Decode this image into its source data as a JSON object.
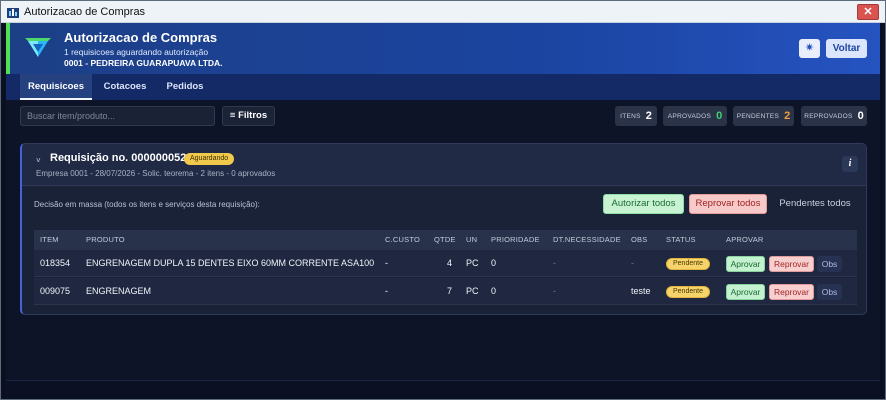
{
  "window": {
    "title": "Autorizacao de Compras",
    "close_glyph": "✕"
  },
  "header": {
    "title": "Autorizacao de Compras",
    "subtitle": "1 requisicoes aguardando autorização",
    "company": "0001 - PEDREIRA GUARAPUAVA LTDA.",
    "icon_button_glyph": "✷",
    "voltar_label": "Voltar",
    "accent_color": "#4fe05a"
  },
  "tabs": [
    {
      "label": "Requisicoes",
      "active": true
    },
    {
      "label": "Cotacoes",
      "active": false
    },
    {
      "label": "Pedidos",
      "active": false
    }
  ],
  "toolbar": {
    "search_placeholder": "Buscar item/produto...",
    "filtros_label": "≡ Filtros"
  },
  "stats": [
    {
      "label": "ITENS",
      "value": "2",
      "color": "#ffffff"
    },
    {
      "label": "APROVADOS",
      "value": "0",
      "color": "#3fd16a"
    },
    {
      "label": "PENDENTES",
      "value": "2",
      "color": "#f0a040"
    },
    {
      "label": "REPROVADOS",
      "value": "0",
      "color": "#ffffff"
    }
  ],
  "requisition": {
    "chevron": "˅",
    "title": "Requisição no. 0000000528",
    "status_badge": "Aguardando",
    "subtitle": "Empresa 0001 - 28/07/2026 - Solic. teorema - 2 itens - 0 aprovados",
    "info_glyph": "i",
    "mass_decision_text": "Decisão em massa (todos os itens e serviços desta requisição):",
    "autorizar_todos_label": "Autorizar todos",
    "reprovar_todos_label": "Reprovar todos",
    "pendentes_todos_label": "Pendentes todos"
  },
  "table": {
    "columns": [
      "ITEM",
      "PRODUTO",
      "C.CUSTO",
      "QTDE",
      "UN",
      "PRIORIDADE",
      "DT.NECESSIDADE",
      "OBS",
      "STATUS",
      "APROVAR"
    ],
    "rows": [
      {
        "item": "018354",
        "produto": "ENGRENAGEM DUPLA 15 DENTES EIXO 60MM CORRENTE ASA100",
        "ccusto": "-",
        "qtde": "4",
        "un": "PC",
        "prioridade": "0",
        "dt_necessidade": "-",
        "obs": "-",
        "status": "Pendente",
        "aprovar_label": "Aprovar",
        "reprovar_label": "Reprovar",
        "obs_label": "Obs"
      },
      {
        "item": "009075",
        "produto": "ENGRENAGEM",
        "ccusto": "-",
        "qtde": "7",
        "un": "PC",
        "prioridade": "0",
        "dt_necessidade": "-",
        "obs": "teste",
        "status": "Pendente",
        "aprovar_label": "Aprovar",
        "reprovar_label": "Reprovar",
        "obs_label": "Obs"
      }
    ]
  }
}
